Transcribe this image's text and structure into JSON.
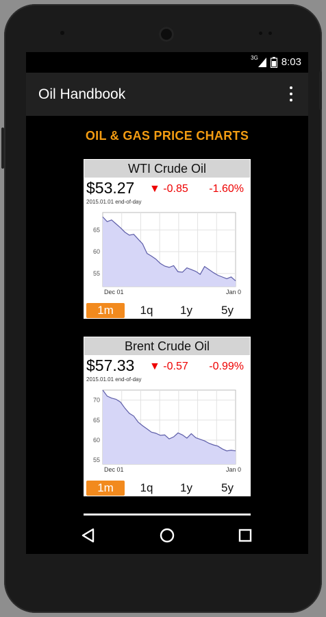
{
  "status": {
    "network": "3G",
    "time": "8:03"
  },
  "appbar": {
    "title": "Oil Handbook"
  },
  "section_title": "OIL & GAS PRICE CHARTS",
  "cards": [
    {
      "title": "WTI Crude Oil",
      "price": "$53.27",
      "change": "▼ -0.85",
      "pct": "-1.60%",
      "asof": "2015.01.01 end-of-day",
      "chart_data": {
        "type": "area",
        "x_labels": [
          "Dec 01",
          "Jan 0"
        ],
        "ylim": [
          52,
          69
        ],
        "yticks": [
          55,
          60,
          65
        ],
        "values": [
          68.0,
          66.9,
          67.3,
          66.4,
          65.5,
          64.5,
          63.8,
          64.0,
          62.9,
          61.8,
          59.6,
          59.0,
          58.3,
          57.3,
          56.7,
          56.4,
          56.8,
          55.4,
          55.3,
          56.3,
          55.9,
          55.5,
          54.8,
          56.6,
          55.9,
          55.2,
          54.6,
          54.2,
          53.8,
          54.2,
          53.3
        ]
      },
      "ranges": [
        "1m",
        "1q",
        "1y",
        "5y"
      ],
      "active_range": "1m"
    },
    {
      "title": "Brent Crude Oil",
      "price": "$57.33",
      "change": "▼ -0.57",
      "pct": "-0.99%",
      "asof": "2015.01.01 end-of-day",
      "chart_data": {
        "type": "area",
        "x_labels": [
          "Dec 01",
          "Jan 0"
        ],
        "ylim": [
          54,
          72.5
        ],
        "yticks": [
          55,
          60,
          65,
          70
        ],
        "values": [
          72.5,
          71.0,
          70.5,
          70.2,
          69.5,
          68.0,
          66.7,
          66.0,
          64.5,
          63.6,
          62.8,
          62.0,
          61.7,
          61.2,
          61.3,
          60.3,
          60.8,
          61.8,
          61.3,
          60.5,
          61.6,
          60.6,
          60.2,
          59.8,
          59.2,
          58.8,
          58.5,
          57.8,
          57.3,
          57.5,
          57.3
        ]
      },
      "ranges": [
        "1m",
        "1q",
        "1y",
        "5y"
      ],
      "active_range": "1m"
    }
  ]
}
